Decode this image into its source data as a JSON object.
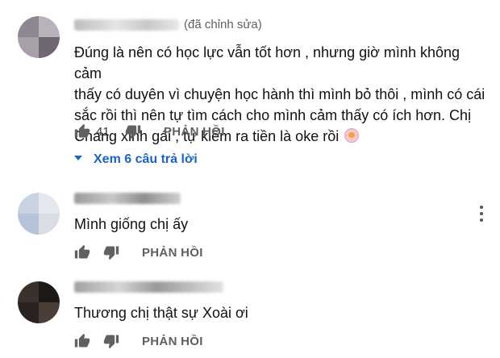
{
  "comments": [
    {
      "edited_label": "(đã chỉnh sửa)",
      "text_lines": [
        "Đúng là nên có học lực vẫn tốt hơn , nhưng giờ mình không cảm",
        "thấy có duyên vì chuyện học hành thì mình bỏ thôi , mình có cái",
        "sắc rồi thì nên tự tìm cách cho mình cảm thấy có ích hơn. Chị",
        "Chang xinh gái , tự kiếm ra tiền là oke rồi"
      ],
      "like_count": "41",
      "reply_label": "PHẢN HỒI",
      "view_replies_label": "Xem 6 câu trả lời"
    },
    {
      "text_lines": [
        "Mình giống chị ấy"
      ],
      "reply_label": "PHẢN HỒI"
    },
    {
      "text_lines": [
        "Thương chị thật sự Xoài ơi"
      ],
      "reply_label": "PHẢN HỒI"
    }
  ],
  "icons": {
    "like": "thumbs-up-icon",
    "dislike": "thumbs-down-icon",
    "more": "more-vert-icon",
    "emoji": "lion-emoji-icon"
  },
  "colors": {
    "link": "#1a64c8",
    "secondary_text": "#606060"
  }
}
